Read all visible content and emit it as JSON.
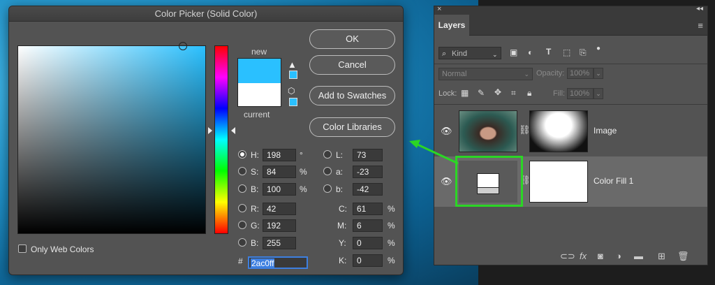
{
  "dialog": {
    "title": "Color Picker (Solid Color)",
    "buttons": {
      "ok": "OK",
      "cancel": "Cancel",
      "add_swatches": "Add to Swatches",
      "color_libraries": "Color Libraries"
    },
    "swatch": {
      "new_label": "new",
      "current_label": "current",
      "new_color": "#2ac0ff",
      "current_color": "#ffffff"
    },
    "hsb": {
      "h": {
        "label": "H:",
        "value": "198",
        "unit": "°"
      },
      "s": {
        "label": "S:",
        "value": "84",
        "unit": "%"
      },
      "b": {
        "label": "B:",
        "value": "100",
        "unit": "%"
      }
    },
    "lab": {
      "l": {
        "label": "L:",
        "value": "73"
      },
      "a": {
        "label": "a:",
        "value": "-23"
      },
      "b": {
        "label": "b:",
        "value": "-42"
      }
    },
    "rgb": {
      "r": {
        "label": "R:",
        "value": "42"
      },
      "g": {
        "label": "G:",
        "value": "192"
      },
      "b": {
        "label": "B:",
        "value": "255"
      }
    },
    "cmyk": {
      "c": {
        "label": "C:",
        "value": "61",
        "unit": "%"
      },
      "m": {
        "label": "M:",
        "value": "6",
        "unit": "%"
      },
      "y": {
        "label": "Y:",
        "value": "0",
        "unit": "%"
      },
      "k": {
        "label": "K:",
        "value": "0",
        "unit": "%"
      }
    },
    "hex": {
      "label": "#",
      "value": "2ac0ff"
    },
    "only_web_colors": "Only Web Colors"
  },
  "layers_panel": {
    "tab_label": "Layers",
    "filter_kind": "Kind",
    "blend_mode": "Normal",
    "opacity_label": "Opacity:",
    "opacity_value": "100%",
    "lock_label": "Lock:",
    "fill_label": "Fill:",
    "fill_value": "100%",
    "layers": [
      {
        "name": "Image"
      },
      {
        "name": "Color Fill 1"
      }
    ],
    "footer_icons": [
      "link-icon",
      "fx-icon",
      "mask-icon",
      "adjustment-icon",
      "folder-icon",
      "new-layer-icon",
      "trash-icon"
    ]
  },
  "colors": {
    "accent_green": "#2bd625",
    "selection_blue": "#3d7fe0"
  }
}
